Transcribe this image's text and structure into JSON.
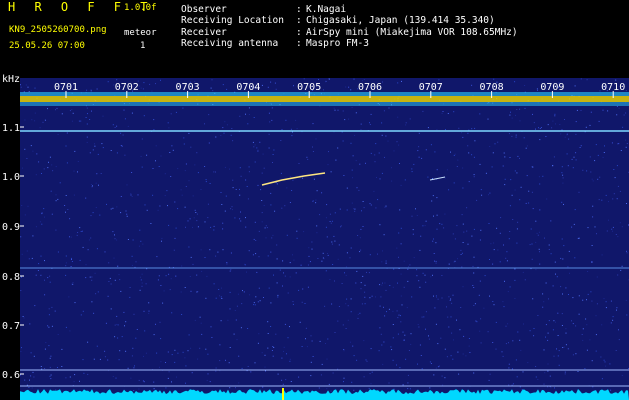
{
  "header": {
    "brand": "H R O F F T",
    "version": "1.0.0f",
    "filename": "KN9_2505260700.png",
    "meteor_label": "meteor",
    "datetime": "25.05.26 07:00",
    "meteor_count": "1",
    "meta": [
      {
        "label": "Observer",
        "value": "K.Nagai"
      },
      {
        "label": "Receiving Location",
        "value": "Chigasaki, Japan (139.414 35.340)"
      },
      {
        "label": "Receiver",
        "value": "AirSpy mini (Miakejima VOR 108.65MHz)"
      },
      {
        "label": "Receiving antenna",
        "value": "Maspro FM-3"
      }
    ]
  },
  "plot": {
    "y_unit": "kHz",
    "time_ticks": [
      "0701",
      "0702",
      "0703",
      "0704",
      "0705",
      "0706",
      "0707",
      "0708",
      "0709",
      "0710"
    ],
    "freq_ticks": [
      "1.1",
      "1.0",
      "0.9",
      "0.8",
      "0.7",
      "0.6"
    ],
    "colors": {
      "noise": "#1e2a8c",
      "band": "#ffee00",
      "line": "#7fd8ff",
      "power": "#00d8ff",
      "marker": "#ffff00"
    }
  }
}
